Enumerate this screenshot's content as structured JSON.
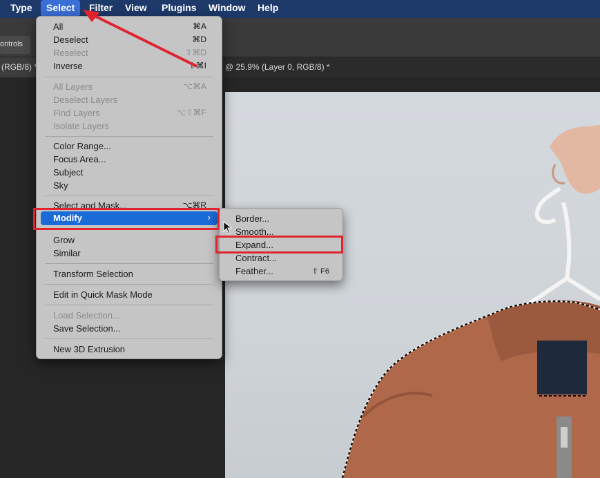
{
  "menubar": {
    "items": [
      {
        "label": "Type"
      },
      {
        "label": "Select"
      },
      {
        "label": "Filter"
      },
      {
        "label": "View"
      },
      {
        "label": "Plugins"
      },
      {
        "label": "Window"
      },
      {
        "label": "Help"
      }
    ]
  },
  "options_bar": {
    "label": "ontrols"
  },
  "tabs": [
    {
      "label": "(RGB/8) *"
    },
    {
      "label": "@ 25.9% (Layer 0, RGB/8) *"
    }
  ],
  "select_menu": {
    "items": [
      {
        "label": "All",
        "shortcut": "⌘A",
        "disabled": false
      },
      {
        "label": "Deselect",
        "shortcut": "⌘D",
        "disabled": false
      },
      {
        "label": "Reselect",
        "shortcut": "⇧⌘D",
        "disabled": true
      },
      {
        "label": "Inverse",
        "shortcut": "⇧⌘I",
        "disabled": false
      },
      {
        "label": "All Layers",
        "shortcut": "⌥⌘A",
        "disabled": true
      },
      {
        "label": "Deselect Layers",
        "shortcut": "",
        "disabled": true
      },
      {
        "label": "Find Layers",
        "shortcut": "⌥⇧⌘F",
        "disabled": true
      },
      {
        "label": "Isolate Layers",
        "shortcut": "",
        "disabled": true
      },
      {
        "label": "Color Range...",
        "shortcut": "",
        "disabled": false
      },
      {
        "label": "Focus Area...",
        "shortcut": "",
        "disabled": false
      },
      {
        "label": "Subject",
        "shortcut": "",
        "disabled": false
      },
      {
        "label": "Sky",
        "shortcut": "",
        "disabled": false
      },
      {
        "label": "Select and Mask...",
        "shortcut": "⌥⌘R",
        "disabled": false
      },
      {
        "label": "Modify",
        "shortcut": "›",
        "disabled": false,
        "highlighted": true
      },
      {
        "label": "Grow",
        "shortcut": "",
        "disabled": false
      },
      {
        "label": "Similar",
        "shortcut": "",
        "disabled": false
      },
      {
        "label": "Transform Selection",
        "shortcut": "",
        "disabled": false
      },
      {
        "label": "Edit in Quick Mask Mode",
        "shortcut": "",
        "disabled": false
      },
      {
        "label": "Load Selection...",
        "shortcut": "",
        "disabled": true
      },
      {
        "label": "Save Selection...",
        "shortcut": "",
        "disabled": false
      },
      {
        "label": "New 3D Extrusion",
        "shortcut": "",
        "disabled": false
      }
    ]
  },
  "modify_submenu": {
    "items": [
      {
        "label": "Border...",
        "shortcut": ""
      },
      {
        "label": "Smooth...",
        "shortcut": ""
      },
      {
        "label": "Expand...",
        "shortcut": ""
      },
      {
        "label": "Contract...",
        "shortcut": ""
      },
      {
        "label": "Feather...",
        "shortcut": "⇧ F6"
      }
    ]
  },
  "colors": {
    "menubar": "#1d3a6b",
    "highlight": "#1a6ad8",
    "annotation": "#e0232c",
    "jacket": "#b0684a"
  }
}
